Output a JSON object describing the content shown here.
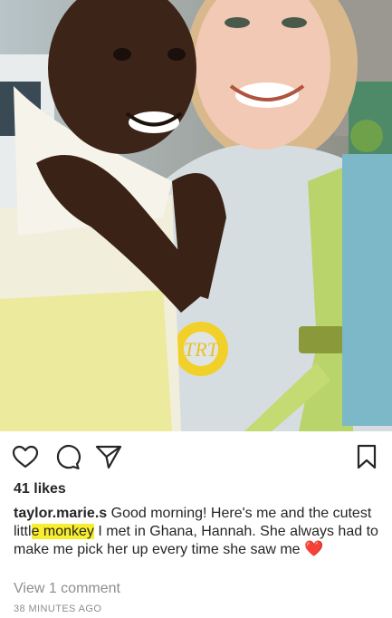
{
  "post": {
    "image": {
      "description": "photo"
    },
    "actions": {
      "like_icon": "heart-outline-icon",
      "comment_icon": "comment-bubble-icon",
      "share_icon": "send-paper-plane-icon",
      "save_icon": "bookmark-outline-icon"
    },
    "likes": "41 likes",
    "caption": {
      "username": "taylor.marie.s",
      "text_part1": "Good morning! Here's me and the cutest littl",
      "highlight": "e monkey",
      "text_part2": " I met in Ghana, Hannah. She always had to make me pick her up every time she saw me ",
      "emoji": "❤️"
    },
    "view_comments": "View 1 comment",
    "timestamp": "38 MINUTES AGO",
    "colors": {
      "text": "#262626",
      "secondary": "#8e8e8e",
      "highlight": "#f8ee2e",
      "heart": "#e01e37"
    }
  }
}
